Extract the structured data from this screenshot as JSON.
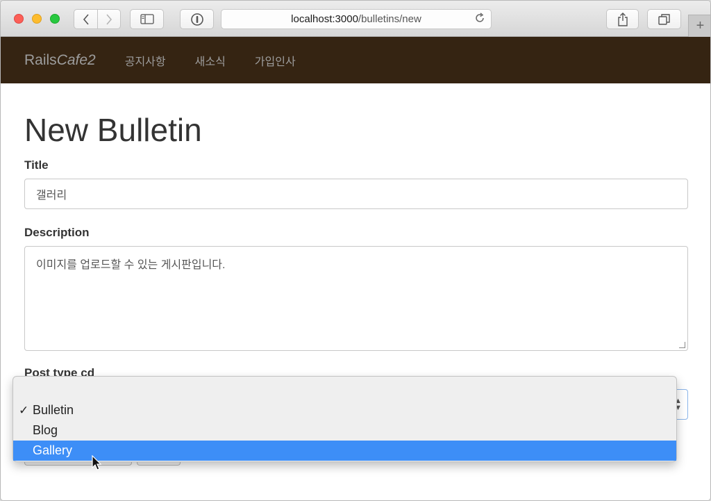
{
  "browser": {
    "url_host": "localhost:3000",
    "url_path": "/bulletins/new",
    "new_tab_label": "+"
  },
  "navbar": {
    "brand_rails": "Rails",
    "brand_cafe": "Cafe2",
    "items": [
      {
        "label": "공지사항"
      },
      {
        "label": "새소식"
      },
      {
        "label": "가입인사"
      }
    ]
  },
  "page": {
    "title": "New Bulletin"
  },
  "form": {
    "title_label": "Title",
    "title_value": "갤러리",
    "description_label": "Description",
    "description_value": "이미지를 업로드할 수 있는 게시판입니다.",
    "post_type_label": "Post type cd",
    "post_type_options": [
      {
        "label": "Bulletin",
        "checked": true
      },
      {
        "label": "Blog",
        "checked": false
      },
      {
        "label": "Gallery",
        "checked": false,
        "highlighted": true
      }
    ]
  },
  "colors": {
    "navbar_bg": "#352412",
    "highlight": "#3d8ef7"
  }
}
